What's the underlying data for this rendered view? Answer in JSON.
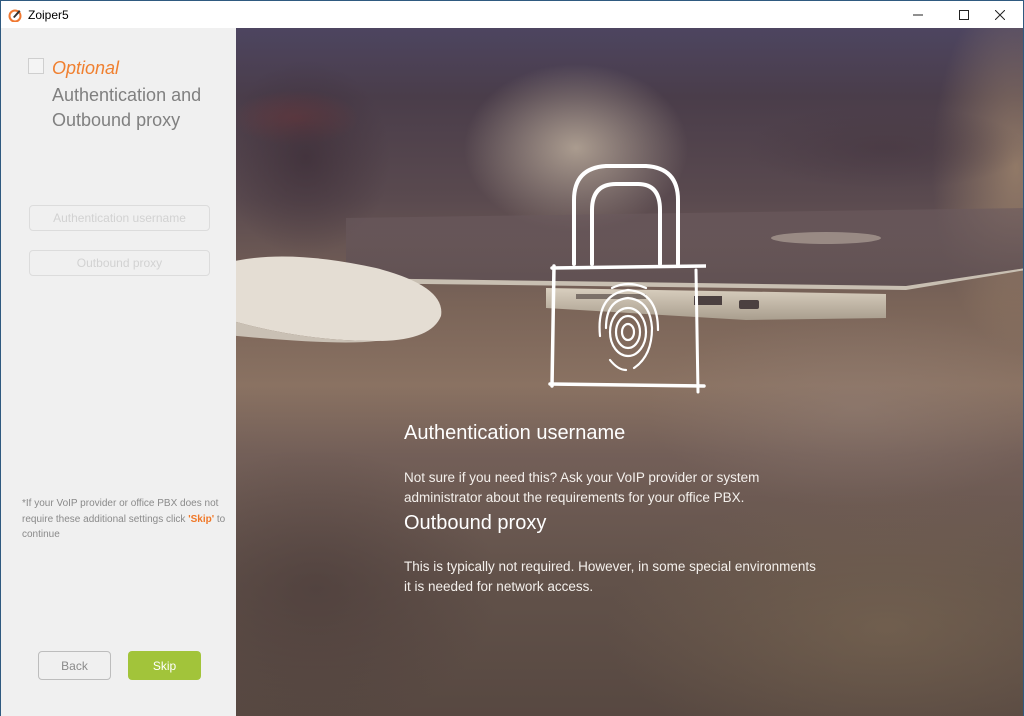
{
  "window": {
    "title": "Zoiper5",
    "controls": {
      "minimize_icon": "minimize-icon",
      "maximize_icon": "maximize-icon",
      "close_icon": "close-icon"
    }
  },
  "sidebar": {
    "step": {
      "optional_label": "Optional",
      "title": "Authentication and Outbound proxy",
      "checked": false
    },
    "fields": [
      {
        "label": "Authentication username"
      },
      {
        "label": "Outbound proxy"
      }
    ],
    "note": {
      "prefix": "*If your VoIP provider or office PBX does not require these additional settings click ",
      "skip_word": "'Skip'",
      "suffix": " to continue"
    },
    "buttons": {
      "back": "Back",
      "skip": "Skip"
    }
  },
  "hero": {
    "icon": "padlock-fingerprint-icon",
    "sections": [
      {
        "heading": "Authentication username",
        "text": "Not sure if you need this? Ask your VoIP provider or system administrator about the requirements for your office PBX."
      },
      {
        "heading": "Outbound proxy",
        "text": "This is typically not required. However, in some special environments it is needed for network access."
      }
    ]
  },
  "colors": {
    "accent_orange": "#f08030",
    "skip_green": "#a2c43a",
    "sidebar_bg": "#f0f0f0"
  }
}
